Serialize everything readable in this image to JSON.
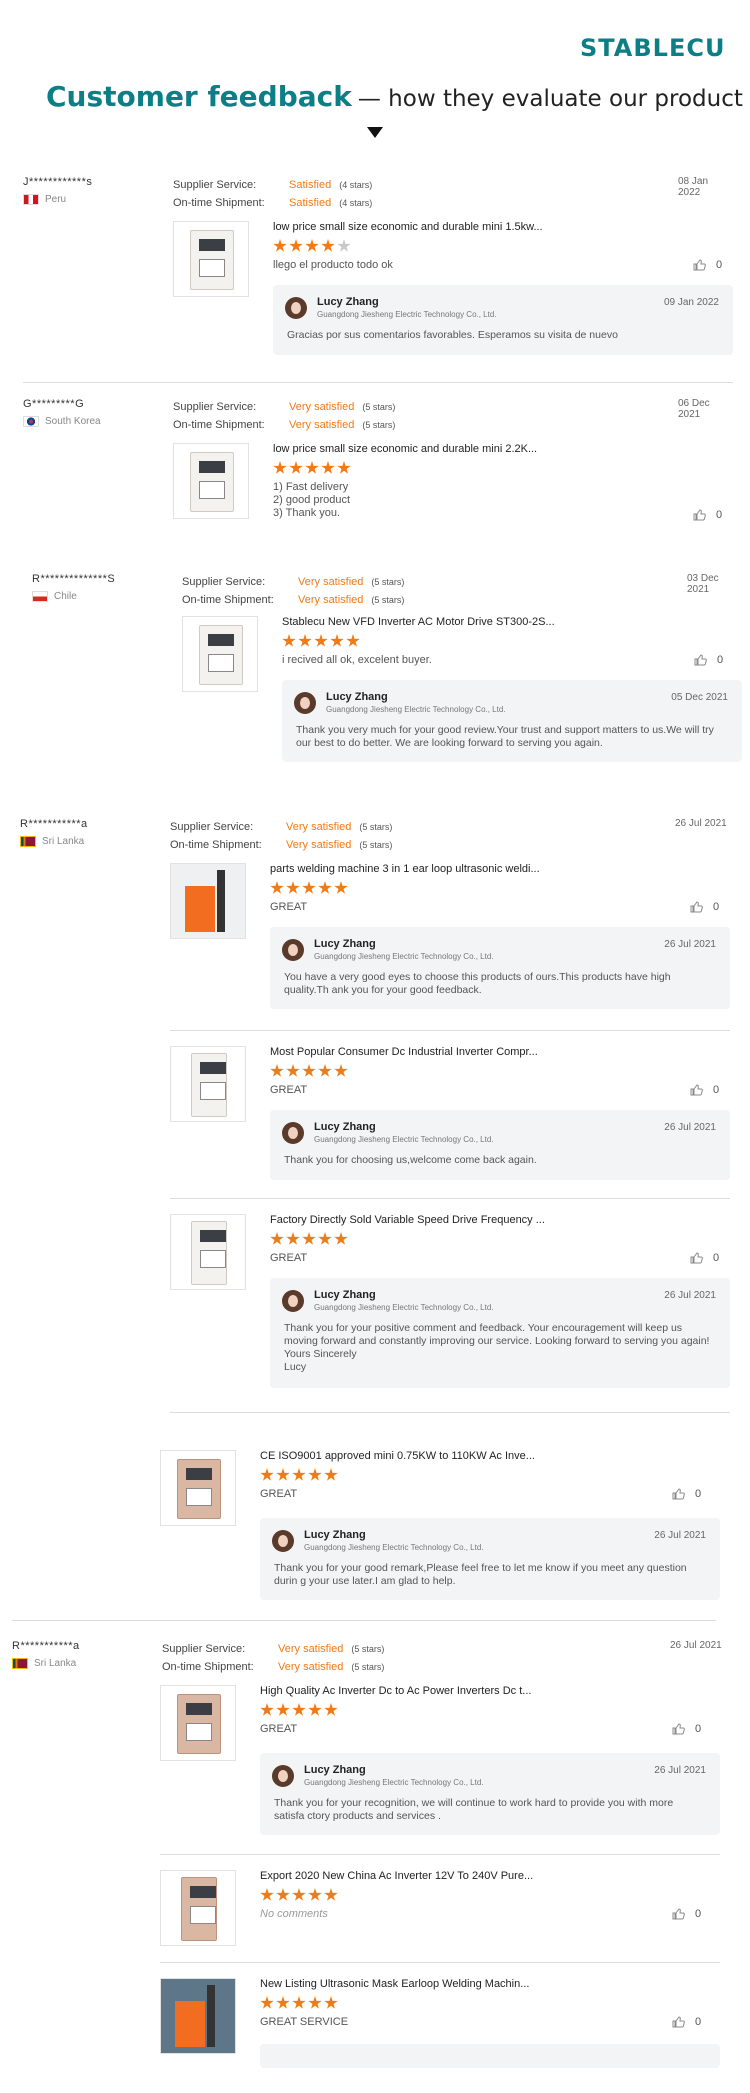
{
  "brand": {
    "logo": "STABLECU",
    "color": "#0b7e86",
    "accent": "#f07a16"
  },
  "header": {
    "title": "Customer feedback",
    "subtitle": "— how they evaluate our product"
  },
  "labels": {
    "supplier_service": "Supplier Service:",
    "on_time_shipment": "On-time Shipment:"
  },
  "reply_author": {
    "name": "Lucy Zhang",
    "company": "Guangdong Jiesheng Electric Technology Co., Ltd."
  },
  "reviews": [
    {
      "user": "J************s",
      "country": "Peru",
      "service": "Satisfied",
      "service_stars": "(4 stars)",
      "shipment": "Satisfied",
      "shipment_stars": "(4 stars)",
      "date": "08 Jan 2022",
      "items": [
        {
          "title": "low price small size economic and durable mini 1.5kw...",
          "rating": 4,
          "comment": "llego el producto todo ok",
          "likes": "0",
          "reply_date": "09 Jan 2022",
          "reply": "Gracias por sus comentarios favorables. Esperamos su visita de nuevo"
        }
      ]
    },
    {
      "user": "G*********G",
      "country": "South Korea",
      "service": "Very satisfied",
      "service_stars": "(5 stars)",
      "shipment": "Very satisfied",
      "shipment_stars": "(5 stars)",
      "date": "06 Dec 2021",
      "items": [
        {
          "title": "low price small size economic and durable mini 2.2K...",
          "rating": 5,
          "comment_lines": [
            "1) Fast delivery",
            "2) good product",
            "3) Thank you."
          ],
          "likes": "0"
        }
      ]
    },
    {
      "user": "R**************S",
      "country": "Chile",
      "service": "Very satisfied",
      "service_stars": "(5 stars)",
      "shipment": "Very satisfied",
      "shipment_stars": "(5 stars)",
      "date": "03 Dec 2021",
      "items": [
        {
          "title": "Stablecu New VFD Inverter AC Motor Drive ST300-2S...",
          "rating": 5,
          "comment": "i recived all ok, excelent buyer.",
          "likes": "0",
          "reply_date": "05 Dec 2021",
          "reply": "Thank you very much for your good review.Your trust and support matters to us.We will try our best to do better. We are looking forward to serving you again."
        }
      ]
    },
    {
      "user": "R***********a",
      "country": "Sri Lanka",
      "service": "Very satisfied",
      "service_stars": "(5 stars)",
      "shipment": "Very satisfied",
      "shipment_stars": "(5 stars)",
      "date": "26 Jul 2021",
      "items": [
        {
          "title": "parts welding machine 3 in 1 ear loop ultrasonic weldi...",
          "rating": 5,
          "comment": "GREAT",
          "likes": "0",
          "reply_date": "26 Jul 2021",
          "reply": "You have a very good eyes to choose this products of ours.This products have high quality.Th ank you for your good feedback."
        },
        {
          "title": "Most Popular Consumer Dc Industrial Inverter Compr...",
          "rating": 5,
          "comment": "GREAT",
          "likes": "0",
          "reply_date": "26 Jul 2021",
          "reply": "Thank you for choosing us,welcome come back again."
        },
        {
          "title": "Factory Directly Sold Variable Speed Drive Frequency ...",
          "rating": 5,
          "comment": "GREAT",
          "likes": "0",
          "reply_date": "26 Jul 2021",
          "reply_lines": [
            "Thank you for your positive comment and feedback. Your encouragement will keep us moving forward and constantly improving our service. Looking forward to serving you again!",
            "Yours Sincerely",
            "Lucy"
          ]
        },
        {
          "title": "CE ISO9001 approved mini 0.75KW to 110KW Ac Inve...",
          "rating": 5,
          "comment": "GREAT",
          "likes": "0",
          "reply_date": "26 Jul 2021",
          "reply": "Thank you for your good remark,Please feel free to let me know if you meet any question durin g your use later.I am glad to help."
        }
      ]
    },
    {
      "user": "R***********a",
      "country": "Sri Lanka",
      "service": "Very satisfied",
      "service_stars": "(5 stars)",
      "shipment": "Very satisfied",
      "shipment_stars": "(5 stars)",
      "date": "26 Jul 2021",
      "items": [
        {
          "title": "High Quality Ac Inverter Dc to Ac Power Inverters Dc t...",
          "rating": 5,
          "comment": "GREAT",
          "likes": "0",
          "reply_date": "26 Jul 2021",
          "reply": "Thank you for your recognition, we will continue to work hard to provide you with more satisfa ctory products and services ."
        },
        {
          "title": "Export 2020 New China Ac Inverter 12V To 240V Pure...",
          "rating": 5,
          "comment": "No comments",
          "likes": "0"
        },
        {
          "title": "New Listing Ultrasonic Mask Earloop Welding Machin...",
          "rating": 5,
          "comment": "GREAT SERVICE",
          "likes": "0"
        }
      ]
    }
  ]
}
